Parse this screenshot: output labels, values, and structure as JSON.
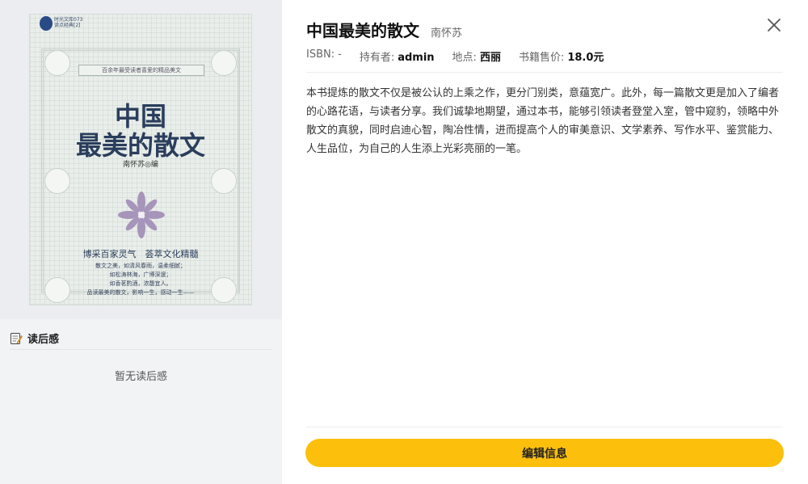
{
  "book": {
    "title": "中国最美的散文",
    "author": "南怀苏",
    "meta": {
      "isbn_label": "ISBN:",
      "isbn_value": "-",
      "owner_label": "持有者:",
      "owner_value": "admin",
      "location_label": "地点:",
      "location_value": "西丽",
      "price_label": "书籍售价:",
      "price_value": "18.0元"
    },
    "description": "本书提炼的散文不仅是被公认的上乘之作，更分门别类，意蕴宽广。此外，每一篇散文更是加入了编者的心路花语，与读者分享。我们诚挚地期望，通过本书，能够引领读者登堂入室，管中窥豹，领略中外散文的真貌，同时启迪心智，陶冶性情，进而提高个人的审美意识、文学素养、写作水平、鉴赏能力、人生品位，为自己的人生添上光彩亮丽的一笔。"
  },
  "cover": {
    "series_line1": "时光文库073",
    "series_line2": "读点经典[2]",
    "tagline": "百余年最受读者喜爱的精品美文",
    "title_line1": "中国",
    "title_line2": "最美的散文",
    "editor": "南怀苏◎编",
    "slogan": "博采百家灵气　荟萃文化精髓",
    "poem_line1": "散文之美，如清风春雨，温柔细腻；",
    "poem_line2": "如松涛林海，广博深邃；",
    "poem_line3": "如香茗酌酒，浓馥宜人。",
    "poem_line4": "品读最美的散文，影响一生，感动一生——"
  },
  "reviews": {
    "title": "读后感",
    "empty_text": "暂无读后感"
  },
  "actions": {
    "edit_label": "编辑信息"
  },
  "colors": {
    "accent": "#fcc00c",
    "left_panel_bg": "#f2f3f5"
  },
  "icons": {
    "close": "close-icon",
    "reviews": "memo-icon"
  }
}
